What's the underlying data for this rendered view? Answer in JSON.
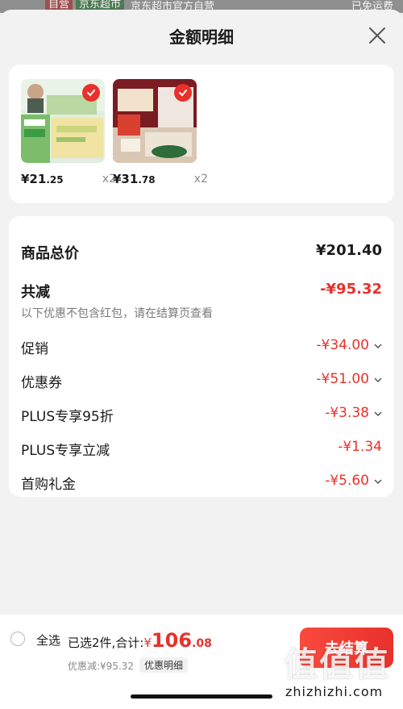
{
  "background_strip": {
    "tag_self": "自营",
    "tag_market": "京东超市",
    "store_name": "京东超市官方自营",
    "shipping": "已免运费"
  },
  "sheet": {
    "title": "金额明细",
    "close_icon": "close-icon"
  },
  "products": [
    {
      "price_int": "¥21",
      "price_dec": ".25",
      "qty": "x2",
      "checked": true
    },
    {
      "price_int": "¥31",
      "price_dec": ".78",
      "qty": "x2",
      "checked": true
    }
  ],
  "details": {
    "total_label": "商品总价",
    "total_value": "¥201.40",
    "reduce_label": "共减",
    "reduce_value": "-¥95.32",
    "note": "以下优惠不包含红包，请在结算页查看",
    "items": [
      {
        "label": "促销",
        "value": "-¥34.00"
      },
      {
        "label": "优惠券",
        "value": "-¥51.00"
      },
      {
        "label": "PLUS专享95折",
        "value": "-¥3.38"
      },
      {
        "label": "PLUS专享立减",
        "value": "-¥1.34"
      },
      {
        "label": "首购礼金",
        "value": "-¥5.60"
      }
    ]
  },
  "bottom_bar": {
    "select_all": "全选",
    "selected_text": "已选2件,",
    "total_text": "合计:",
    "yen": "¥",
    "amount_int": "106",
    "amount_dec": ".08",
    "discount_text": "优惠减:¥95.32",
    "detail_button": "优惠明细",
    "checkout_button": "去结算"
  },
  "watermark": {
    "glyphs": "值值值",
    "url": "zhizhizhi.com"
  },
  "colors": {
    "accent_red": "#e8312b",
    "text_dark": "#1a1a1a",
    "text_gray": "#7a7a7a"
  }
}
